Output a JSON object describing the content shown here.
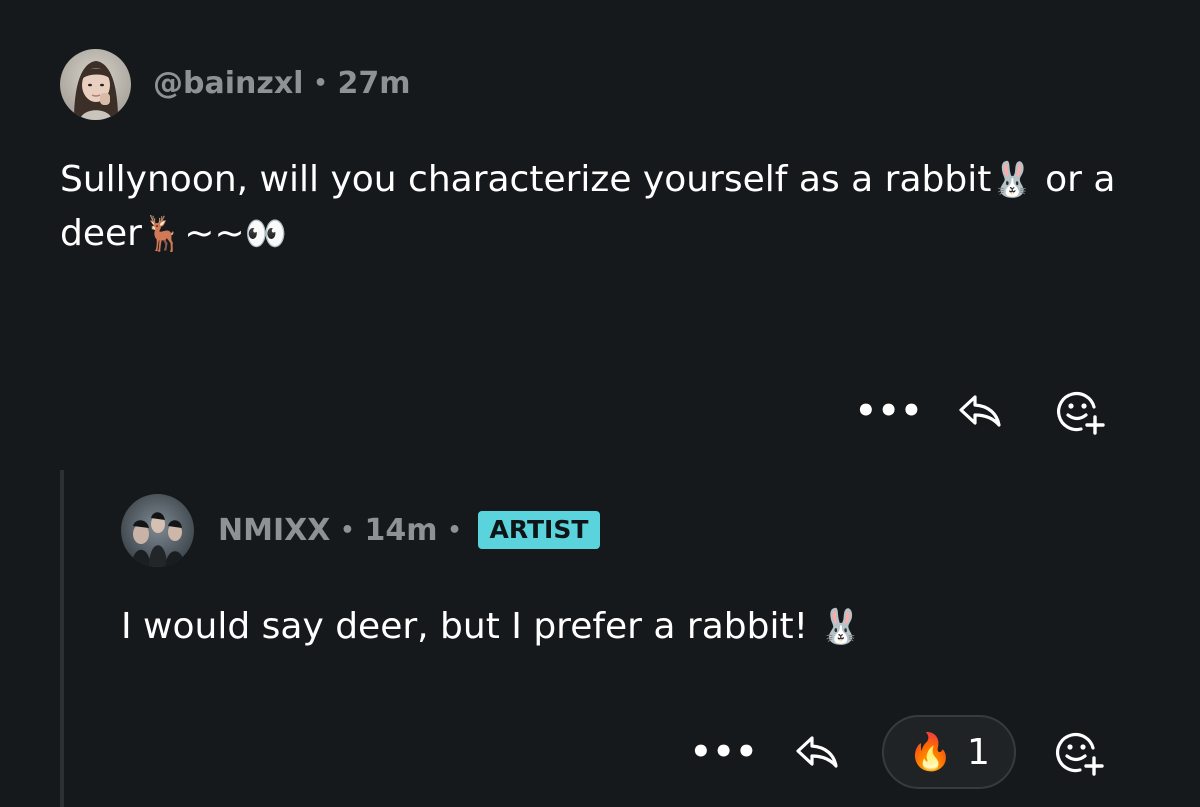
{
  "post": {
    "username": "@bainzxl",
    "time": "27m",
    "text": "Sullynoon, will you characterize yourself as a rabbit",
    "emoji_rabbit": "🐰",
    "text_or": "or a",
    "text_deer": "deer",
    "emoji_deer": "🦌",
    "text_tilde": "~~",
    "emoji_eyes": "👀",
    "more_label": "•••"
  },
  "reply": {
    "username": "NMIXX",
    "time": "14m",
    "badge": "ARTIST",
    "text": "I would say deer, but I prefer a rabbit!",
    "emoji_rabbit": "🐰",
    "more_label": "•••",
    "reaction": {
      "emoji": "🔥",
      "count": "1"
    }
  },
  "separator": "•",
  "icons": {
    "reply": "reply-arrow-icon",
    "add_reaction": "add-reaction-smiley-icon",
    "more": "more-horizontal-icon"
  },
  "colors": {
    "background": "#16191b",
    "meta_text": "#8d9296",
    "badge": "#5bd3dd",
    "pill_border": "#363b3f"
  }
}
